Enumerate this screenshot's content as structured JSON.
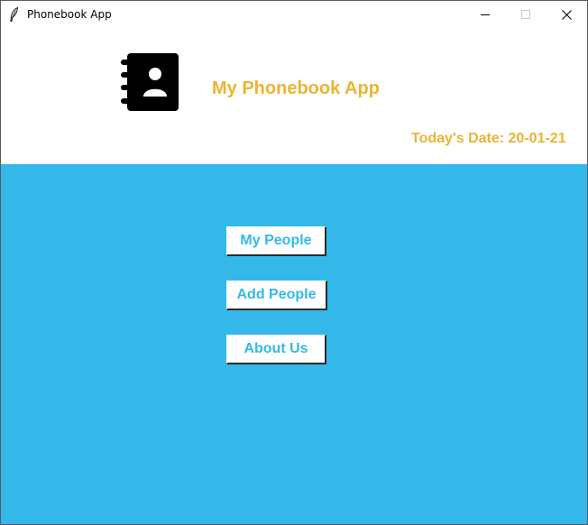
{
  "window": {
    "title": "Phonebook App"
  },
  "header": {
    "heading": "My Phonebook App",
    "date_label": "Today's Date: 20-01-21",
    "logo_icon": "phonebook-contact-icon"
  },
  "menu": {
    "buttons": [
      {
        "label": "My People"
      },
      {
        "label": "Add People"
      },
      {
        "label": "About Us"
      }
    ]
  },
  "colors": {
    "accent_text": "#ebb434",
    "main_background": "#34b8ea",
    "button_text": "#34b8ea",
    "header_background": "#ffffff"
  }
}
